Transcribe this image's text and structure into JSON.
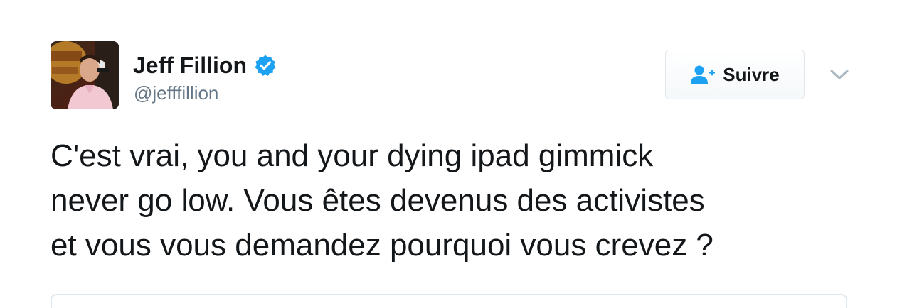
{
  "author": {
    "name": "Jeff Fillion",
    "handle": "@jefffillion",
    "verified": true,
    "avatar_icon": "profile-photo-radio-host"
  },
  "actions": {
    "follow_label": "Suivre",
    "follow_icon": "add-user-icon",
    "more_icon": "chevron-down-icon"
  },
  "tweet": {
    "lines": [
      "C'est vrai, you and your dying ipad gimmick",
      "never go low. Vous êtes devenus des activistes",
      "et vous vous demandez pourquoi vous crevez ?"
    ]
  },
  "colors": {
    "verified_blue": "#1da1f2",
    "text_primary": "#14171a",
    "text_secondary": "#657786",
    "border": "#e1e8ed"
  }
}
